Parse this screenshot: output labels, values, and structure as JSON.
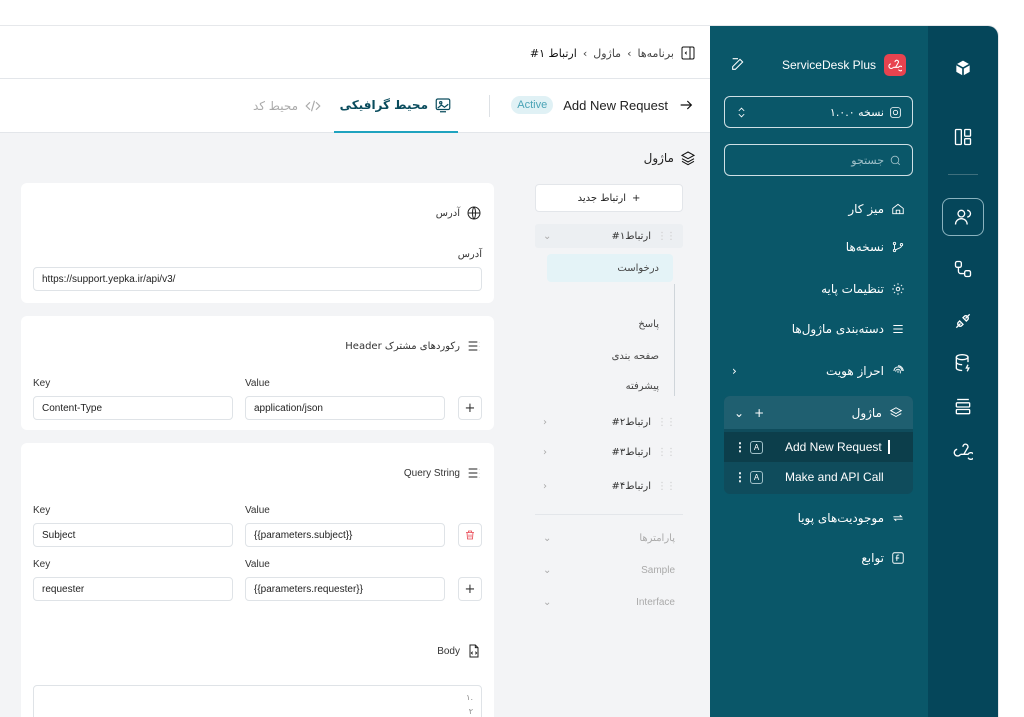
{
  "brand": {
    "name": "ServiceDesk Plus"
  },
  "sidebar": {
    "version_label": "نسخه ۱.۰.۰",
    "search_placeholder": "جستجو",
    "nav": [
      {
        "id": "workspace",
        "label": "میز کار"
      },
      {
        "id": "versions",
        "label": "نسخه‌ها"
      },
      {
        "id": "base-settings",
        "label": "تنظیمات پایه"
      },
      {
        "id": "module-categories",
        "label": "دسته‌بندی ماژول‌ها"
      },
      {
        "id": "authentication",
        "label": "احراز هویت"
      }
    ],
    "modules": {
      "label": "ماژول",
      "items": [
        {
          "badge": "A",
          "name": "Add New Request"
        },
        {
          "badge": "A",
          "name": "Make and API Call"
        }
      ]
    },
    "dynamic_entities": "موجودیت‌های پویا",
    "functions": "توابع"
  },
  "breadcrumb": {
    "root": "برنامه‌ها",
    "mid": "ماژول",
    "current": "ارتباط ۱#"
  },
  "request": {
    "title": "Add New Request",
    "status": "Active"
  },
  "tabs": {
    "graphic": "محیط گرافیکی",
    "code": "محیط کد"
  },
  "module_panel": {
    "title": "ماژول",
    "new_connection": "ارتباط جدید",
    "connections": [
      "ارتباط۱#",
      "ارتباط۲#",
      "ارتباط۳#",
      "ارتباط۴#"
    ],
    "sub_items": [
      "درخواست",
      "پاسخ",
      "صفحه بندی",
      "پیشرفته"
    ],
    "sections": [
      "پارامترها",
      "Sample",
      "Interface"
    ]
  },
  "address_card": {
    "title": "آدرس",
    "field_label": "آدرس",
    "url": "https://support.yepka.ir/api/v3/"
  },
  "headers_card": {
    "title": "رکوردهای مشترک Header",
    "key_label": "Key",
    "value_label": "Value",
    "rows": [
      {
        "key": "Content-Type",
        "value": "application/json"
      }
    ]
  },
  "query_card": {
    "title": "Query String",
    "key_label": "Key",
    "value_label": "Value",
    "rows": [
      {
        "key": "Subject",
        "value": "{{parameters.subject}}"
      },
      {
        "key": "requester",
        "value": "{{parameters.requester}}"
      }
    ]
  },
  "body_card": {
    "title": "Body",
    "lines": [
      "۱.",
      "۲"
    ]
  },
  "colors": {
    "rail": "#05465a",
    "sidebar": "#0a5769",
    "accent": "#1fa3bf",
    "brand": "#e8434f"
  }
}
